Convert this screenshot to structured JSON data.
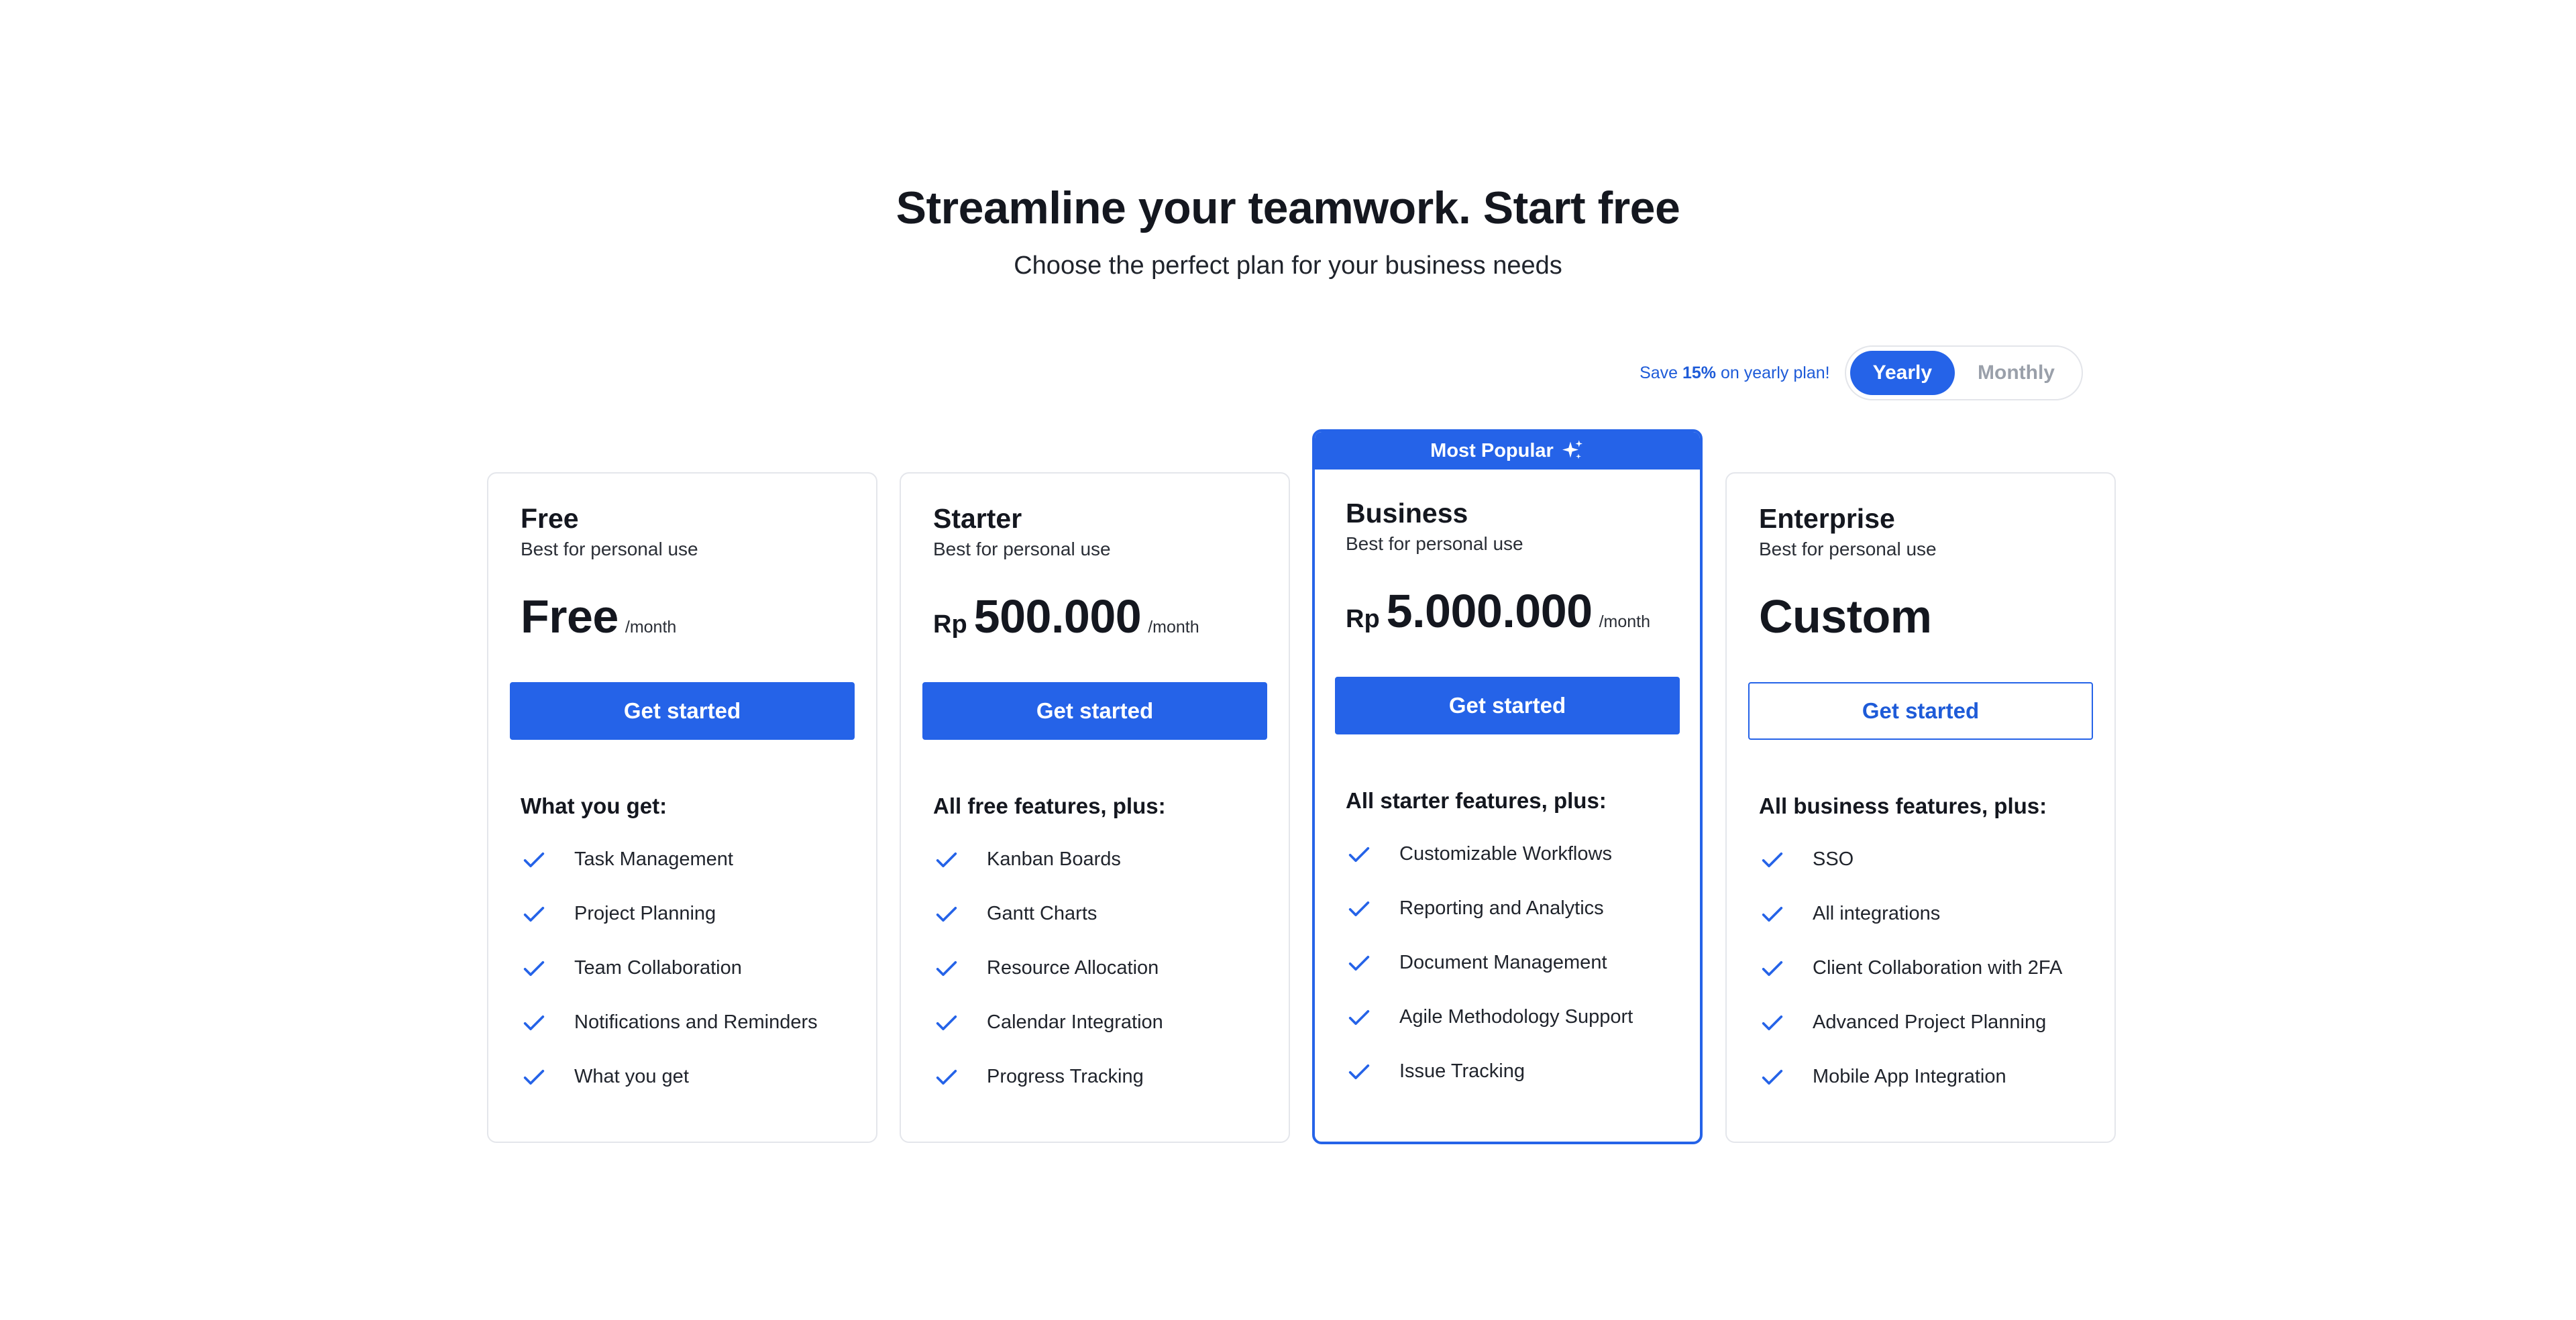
{
  "header": {
    "title": "Streamline your teamwork. Start free",
    "subtitle": "Choose the perfect plan for your business needs"
  },
  "billing": {
    "save_prefix": "Save ",
    "save_percent": "15%",
    "save_suffix": " on yearly plan!",
    "options": [
      "Yearly",
      "Monthly"
    ],
    "selected": "Yearly"
  },
  "colors": {
    "accent": "#2563e8",
    "border": "#e4e6eb",
    "text": "#14171f"
  },
  "plans": [
    {
      "name": "Free",
      "tagline": "Best for personal use",
      "currency": "",
      "price": "Free",
      "period": "/month",
      "cta": "Get started",
      "cta_style": "filled",
      "features_heading": "What you get:",
      "features": [
        "Task Management",
        "Project Planning",
        "Team Collaboration",
        "Notifications and Reminders",
        "What you get"
      ]
    },
    {
      "name": "Starter",
      "tagline": "Best for personal use",
      "currency": "Rp",
      "price": "500.000",
      "period": "/month",
      "cta": "Get started",
      "cta_style": "filled",
      "features_heading": "All free features, plus:",
      "features": [
        "Kanban Boards",
        "Gantt Charts",
        "Resource Allocation",
        "Calendar Integration",
        "Progress Tracking"
      ]
    },
    {
      "name": "Business",
      "badge": "Most Popular",
      "badge_icon": "sparkles-icon",
      "tagline": "Best for personal use",
      "currency": "Rp",
      "price": "5.000.000",
      "period": "/month",
      "cta": "Get started",
      "cta_style": "filled",
      "features_heading": "All starter features, plus:",
      "features": [
        "Customizable Workflows",
        "Reporting and Analytics",
        "Document Management",
        "Agile Methodology Support",
        "Issue Tracking"
      ]
    },
    {
      "name": "Enterprise",
      "tagline": "Best for personal use",
      "currency": "",
      "price": "Custom",
      "period": "",
      "cta": "Get started",
      "cta_style": "outline",
      "features_heading": "All business features, plus:",
      "features": [
        "SSO",
        "All integrations",
        "Client Collaboration with 2FA",
        "Advanced Project Planning",
        "Mobile App Integration"
      ]
    }
  ]
}
